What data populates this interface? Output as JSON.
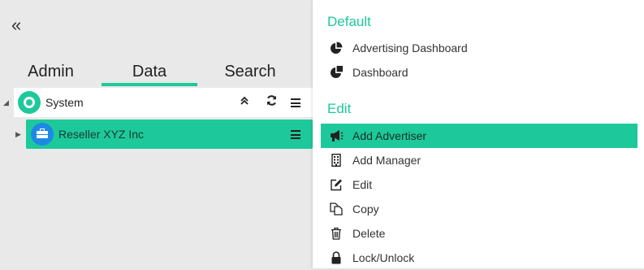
{
  "tabs": [
    {
      "label": "Admin"
    },
    {
      "label": "Data",
      "active": true
    },
    {
      "label": "Search"
    }
  ],
  "tree": {
    "nodes": [
      {
        "label": "System",
        "icon": "target-icon"
      },
      {
        "label": "Reseller XYZ Inc",
        "icon": "briefcase-icon",
        "selected": true
      }
    ]
  },
  "menu": {
    "sections": [
      {
        "title": "Default",
        "items": [
          {
            "label": "Advertising Dashboard",
            "icon": "pie-chart-icon"
          },
          {
            "label": "Dashboard",
            "icon": "pie-chart-icon"
          }
        ]
      },
      {
        "title": "Edit",
        "items": [
          {
            "label": "Add Advertiser",
            "icon": "megaphone-icon",
            "active": true
          },
          {
            "label": "Add Manager",
            "icon": "building-icon"
          },
          {
            "label": "Edit",
            "icon": "pencil-square-icon"
          },
          {
            "label": "Copy",
            "icon": "copy-icon"
          },
          {
            "label": "Delete",
            "icon": "trash-icon"
          },
          {
            "label": "Lock/Unlock",
            "icon": "lock-icon"
          }
        ]
      }
    ]
  },
  "colors": {
    "accent": "#1dc99a",
    "node_blue": "#1e88e5",
    "panel_bg": "#e9e9e9"
  }
}
